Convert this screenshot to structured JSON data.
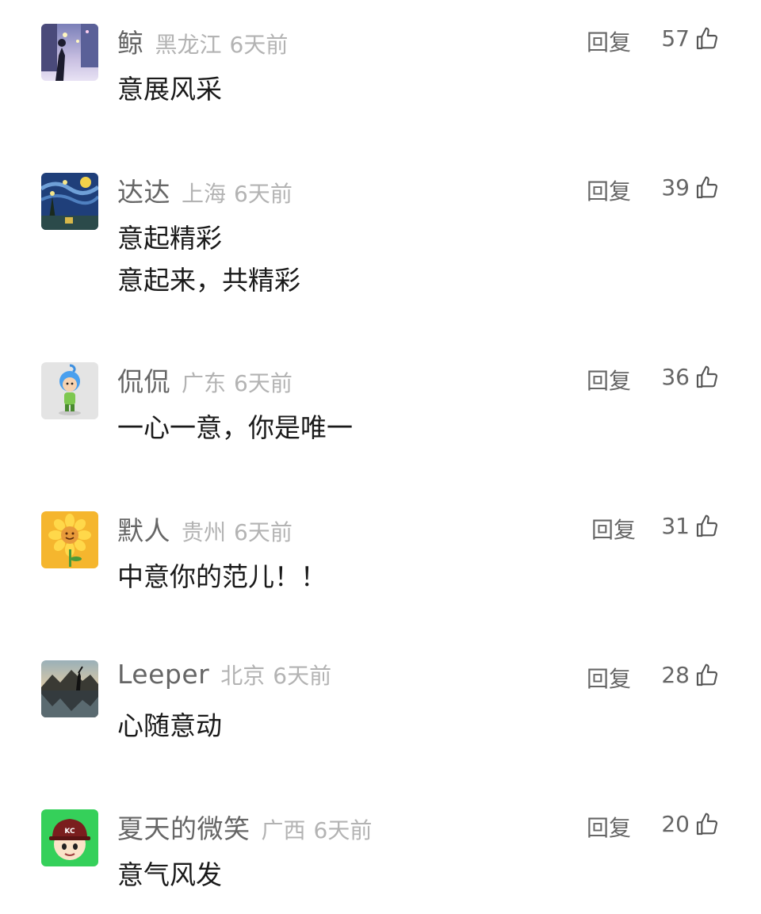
{
  "reply_label": "回复",
  "comments": [
    {
      "username": "鲸",
      "location": "黑龙江",
      "time": "6天前",
      "likes": "57",
      "lines": [
        "意展风采"
      ],
      "avatar_icon": "night-street-photo-avatar"
    },
    {
      "username": "达达",
      "location": "上海",
      "time": "6天前",
      "likes": "39",
      "lines": [
        "意起精彩",
        "意起来，共精彩"
      ],
      "avatar_icon": "starry-night-painting-avatar"
    },
    {
      "username": "侃侃",
      "location": "广东",
      "time": "6天前",
      "likes": "36",
      "lines": [
        "一心一意，你是唯一"
      ],
      "avatar_icon": "cartoon-mascot-avatar"
    },
    {
      "username": "默人",
      "location": "贵州",
      "time": "6天前",
      "likes": "31",
      "lines": [
        "中意你的范儿！！"
      ],
      "avatar_icon": "sunflower-avatar"
    },
    {
      "username": "Leeper",
      "location": "北京",
      "time": "6天前",
      "likes": "28",
      "lines": [
        "心随意动"
      ],
      "avatar_icon": "mountain-lake-avatar"
    },
    {
      "username": "夏天的微笑",
      "location": "广西",
      "time": "6天前",
      "likes": "20",
      "lines": [
        "意气风发"
      ],
      "avatar_icon": "cartoon-boy-cap-avatar"
    }
  ]
}
